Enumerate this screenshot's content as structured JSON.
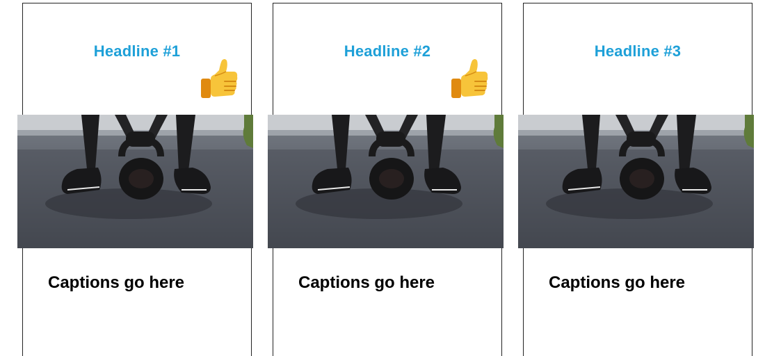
{
  "colors": {
    "headline": "#1ea0d8",
    "caption": "#000000",
    "border": "#222222"
  },
  "cards": [
    {
      "headline": "Headline #1",
      "caption": "Captions go here",
      "icon": "thumbs-up-icon",
      "liked": true,
      "image": "kettlebell-photo"
    },
    {
      "headline": "Headline #2",
      "caption": "Captions go here",
      "icon": "thumbs-up-icon",
      "liked": true,
      "image": "kettlebell-photo"
    },
    {
      "headline": "Headline #3",
      "caption": "Captions go here",
      "icon": "",
      "liked": false,
      "image": "kettlebell-photo"
    }
  ]
}
